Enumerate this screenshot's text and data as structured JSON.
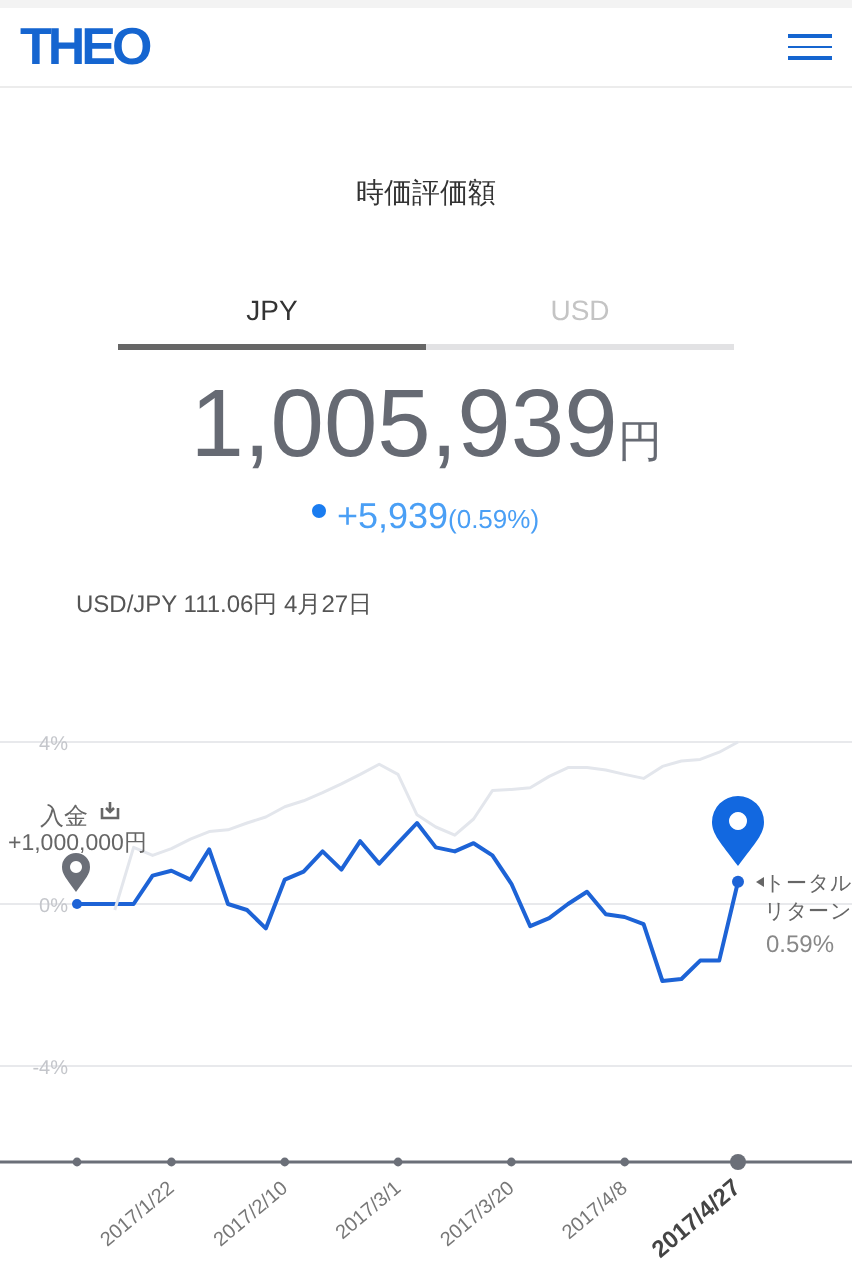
{
  "header": {
    "logo": "THEO"
  },
  "title": "時価評価額",
  "tabs": [
    {
      "label": "JPY",
      "selected": true
    },
    {
      "label": "USD",
      "selected": false
    }
  ],
  "valuation": {
    "amount": "1,005,939",
    "unit": "円",
    "change": "+5,939",
    "change_percent": "(0.59%)"
  },
  "exchange_rate": "USD/JPY 111.06円 4月27日",
  "chart_data": {
    "type": "line",
    "categories": [
      null,
      null,
      null,
      null,
      null,
      "2017/1/22",
      null,
      null,
      null,
      null,
      null,
      "2017/2/10",
      null,
      null,
      null,
      null,
      null,
      "2017/3/1",
      null,
      null,
      null,
      null,
      null,
      "2017/3/20",
      null,
      null,
      null,
      null,
      null,
      "2017/4/8",
      null,
      null,
      null,
      null,
      null,
      "2017/4/27"
    ],
    "series": [
      {
        "color": "#1d63d6",
        "values": [
          0,
          0,
          0,
          0,
          0.7,
          0.82,
          0.6,
          1.35,
          0.0,
          -0.15,
          -0.6,
          0.6,
          0.8,
          1.3,
          0.85,
          1.55,
          1.0,
          1.5,
          2.0,
          1.4,
          1.3,
          1.5,
          1.2,
          0.5,
          -0.55,
          -0.35,
          0,
          0.3,
          -0.25,
          -0.32,
          -0.5,
          -1.9,
          -1.85,
          -1.4,
          -1.4,
          0.55
        ]
      },
      {
        "color": "#e3e6ec",
        "values": [
          null,
          null,
          -0.15,
          1.4,
          1.2,
          1.37,
          1.6,
          1.79,
          1.83,
          2.0,
          2.15,
          2.4,
          2.55,
          2.75,
          2.97,
          3.2,
          3.45,
          3.2,
          2.2,
          1.9,
          1.7,
          2.1,
          2.8,
          2.83,
          2.87,
          3.15,
          3.37,
          3.37,
          3.31,
          3.2,
          3.1,
          3.4,
          3.53,
          3.57,
          3.75,
          4.0
        ]
      }
    ],
    "ylim": [
      -4,
      4
    ],
    "yticks": [
      {
        "value": 4,
        "label": "4%"
      },
      {
        "value": 0,
        "label": "0%"
      },
      {
        "value": -4,
        "label": "-4%"
      }
    ]
  },
  "chart_notes": [
    {
      "kind": "deposit",
      "texts": [
        "入金",
        "+1,000,000円"
      ]
    },
    {
      "kind": "return",
      "texts": [
        "トータル",
        "リターン",
        "0.59%"
      ]
    }
  ]
}
